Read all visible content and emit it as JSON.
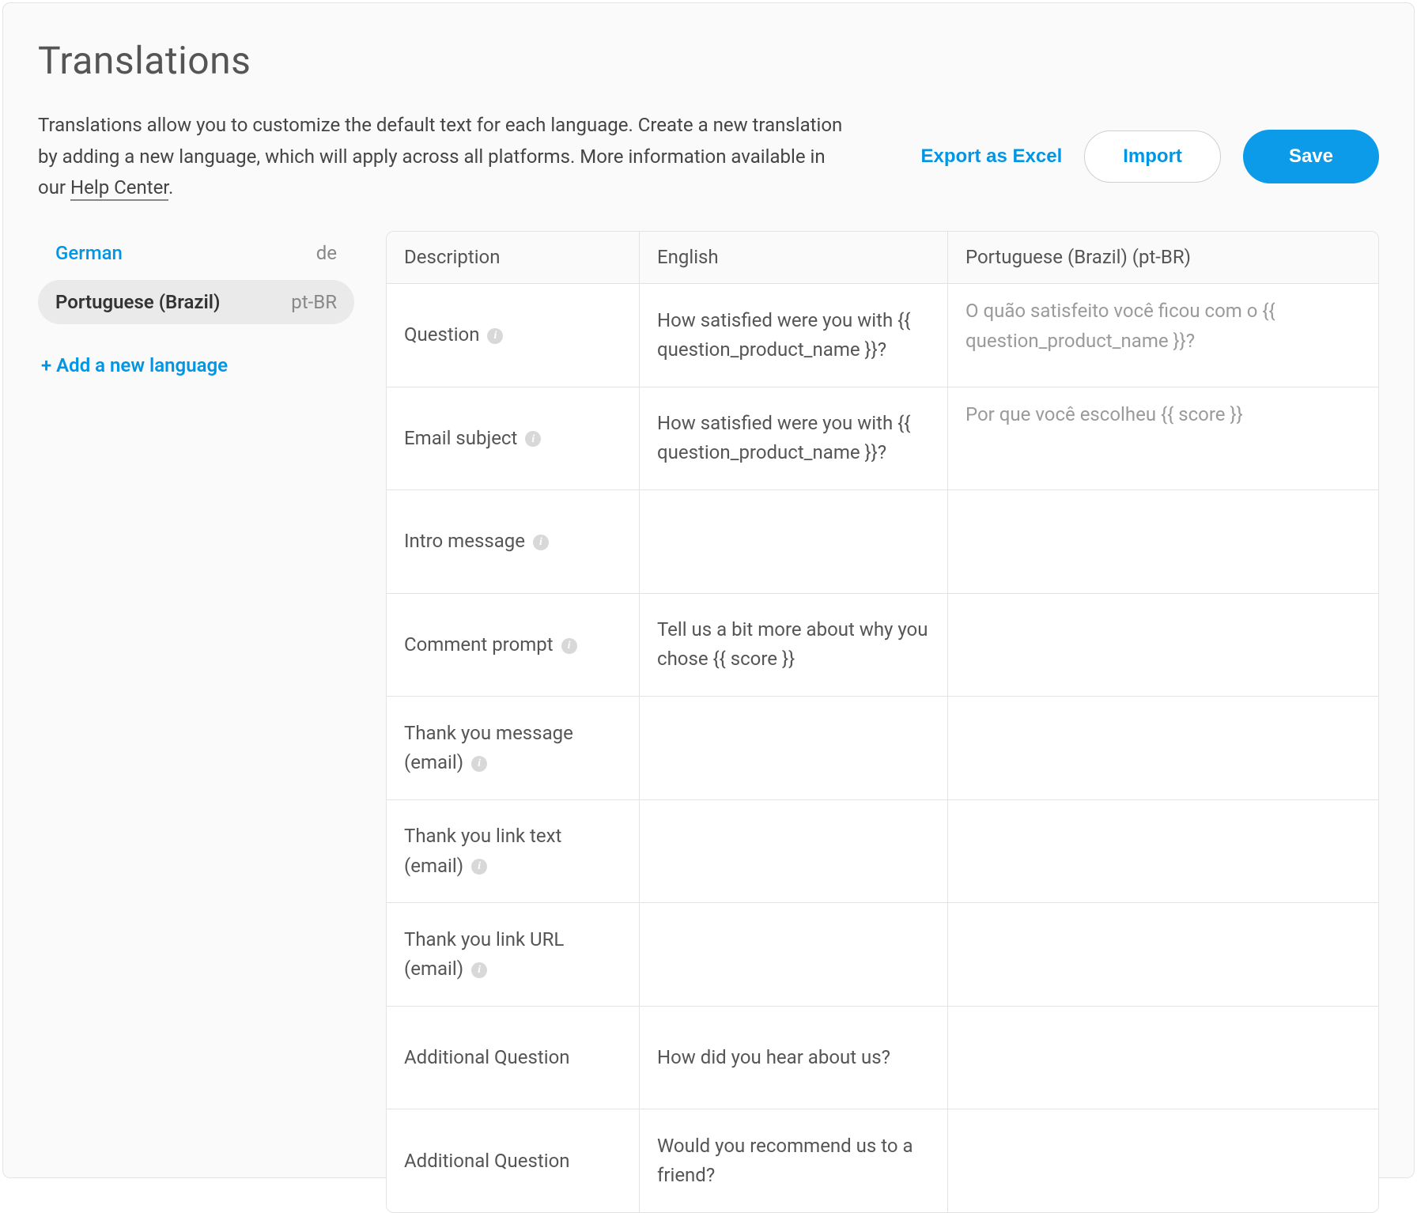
{
  "title": "Translations",
  "intro": {
    "text_a": "Translations allow you to customize the default text for each language. Create a new translation by adding a new language, which will apply across all platforms. More information available in our ",
    "link_label": "Help Center",
    "text_b": "."
  },
  "actions": {
    "export_label": "Export as Excel",
    "import_label": "Import",
    "save_label": "Save"
  },
  "languages": [
    {
      "name": "German",
      "code": "de",
      "selected": false
    },
    {
      "name": "Portuguese (Brazil)",
      "code": "pt-BR",
      "selected": true
    }
  ],
  "add_language_label": "+ Add a new language",
  "table": {
    "headers": {
      "description": "Description",
      "english": "English",
      "target": "Portuguese (Brazil) (pt-BR)"
    },
    "rows": [
      {
        "description": "Question",
        "info": true,
        "english": "How satisfied were you with {{ question_product_name }}?",
        "placeholder": "O quão satisfeito você ficou com o {{ question_product_name }}?",
        "value": ""
      },
      {
        "description": "Email subject",
        "info": true,
        "english": "How satisfied were you with {{ question_product_name }}?",
        "placeholder": "Por que você escolheu {{ score }}",
        "value": ""
      },
      {
        "description": "Intro message",
        "info": true,
        "english": "",
        "placeholder": "",
        "value": ""
      },
      {
        "description": "Comment prompt",
        "info": true,
        "english": "Tell us a bit more about why you chose {{ score }}",
        "placeholder": "",
        "value": ""
      },
      {
        "description": "Thank you message (email)",
        "info": true,
        "english": "",
        "placeholder": "",
        "value": ""
      },
      {
        "description": "Thank you link text (email)",
        "info": true,
        "english": "",
        "placeholder": "",
        "value": ""
      },
      {
        "description": "Thank you link URL (email)",
        "info": true,
        "english": "",
        "placeholder": "",
        "value": ""
      },
      {
        "description": "Additional Question",
        "info": false,
        "english": "How did you hear about us?",
        "placeholder": "",
        "value": ""
      },
      {
        "description": "Additional Question",
        "info": false,
        "english": "Would you recommend us to a friend?",
        "placeholder": "",
        "value": ""
      }
    ]
  }
}
